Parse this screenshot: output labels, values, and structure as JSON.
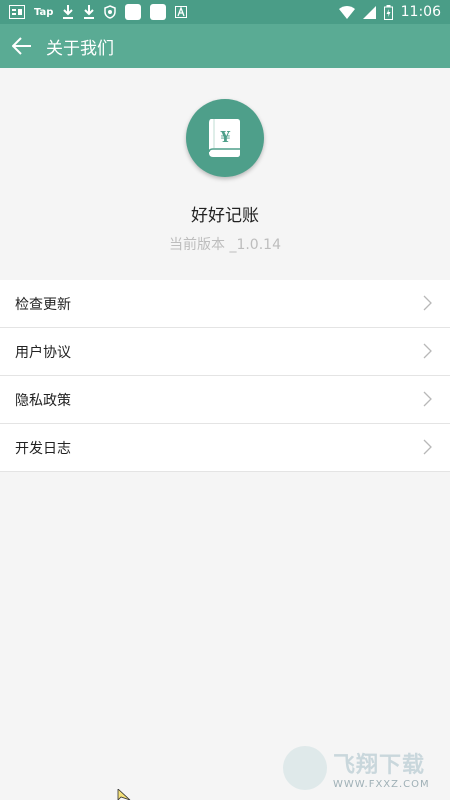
{
  "status_bar": {
    "left_icons": [
      "toutiao-icon",
      "tap-icon",
      "download-icon",
      "download-icon",
      "shield-icon",
      "app-square-icon",
      "app-square-icon",
      "font-icon"
    ],
    "tap_text": "Tap",
    "time": "11:06",
    "right_icons": [
      "wifi-icon",
      "signal-icon",
      "battery-icon"
    ]
  },
  "toolbar": {
    "back_icon": "arrow-left-icon",
    "title": "关于我们"
  },
  "app": {
    "logo_icon": "ledger-book-yen-icon",
    "name": "好好记账",
    "version": "当前版本 _1.0.14"
  },
  "menu": {
    "items": [
      {
        "label": "检查更新"
      },
      {
        "label": "用户协议"
      },
      {
        "label": "隐私政策"
      },
      {
        "label": "开发日志"
      }
    ]
  },
  "watermark": {
    "brand": "飞翔下载",
    "url": "WWW.FXXZ.COM"
  },
  "colors": {
    "statusbar": "#4a9d87",
    "toolbar": "#5aab94",
    "logo_bg": "#4e9f8a",
    "background": "#f5f5f5"
  }
}
